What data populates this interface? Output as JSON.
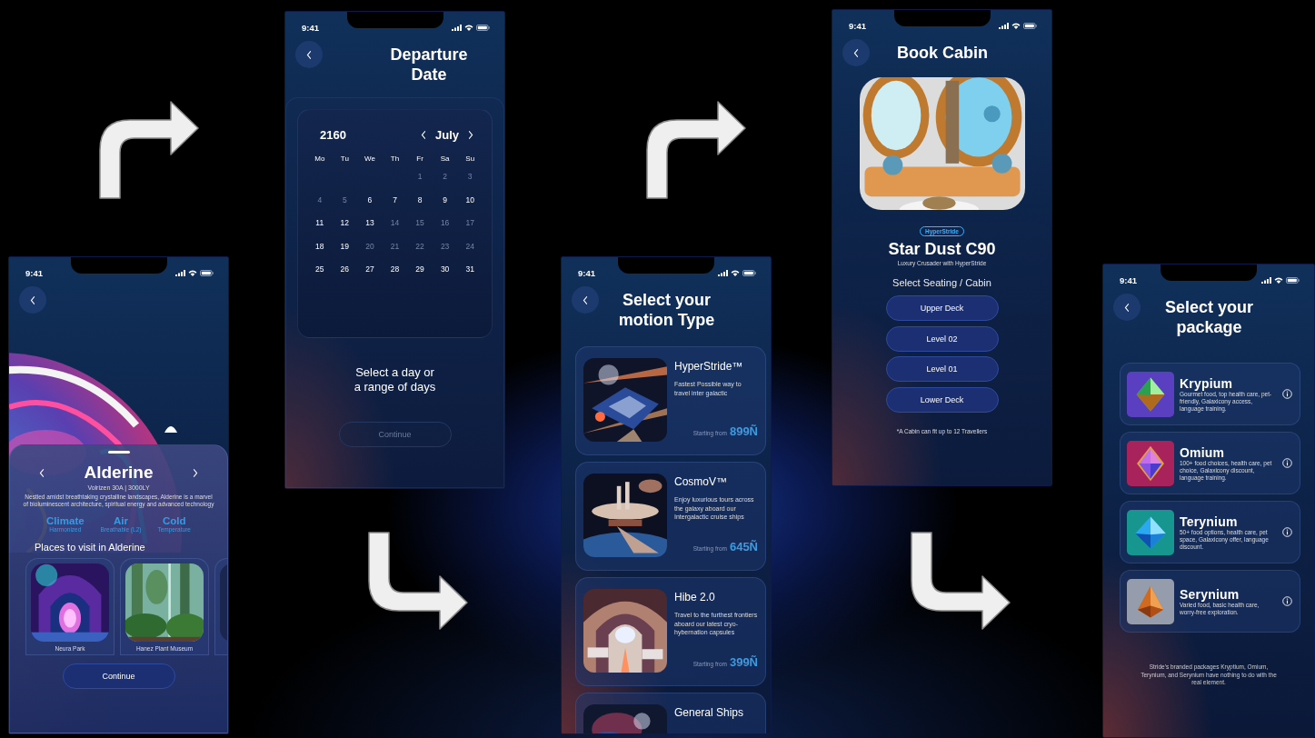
{
  "screens": [
    {
      "kind": "planet",
      "time": "9:41",
      "name": "Alderine",
      "subtitle": "Volrizen 30A | 3000LY",
      "description": "Nestled amidst breathtaking crystalline landscapes, Alderine is a marvel of bioluminescent architecture, spiritual energy and advanced technology",
      "stats": [
        {
          "value": "Climate",
          "caption": "Harmonized"
        },
        {
          "value": "Air",
          "caption": "Breathable (L2)"
        },
        {
          "value": "Cold",
          "caption": "Temperature"
        }
      ],
      "places_title": "Places to visit in Alderine",
      "places": [
        {
          "name": "Neura Park"
        },
        {
          "name": "Hanez Plant Museum"
        }
      ],
      "continue": {
        "label": "Continue",
        "disabled": false
      }
    },
    {
      "kind": "calendar",
      "time": "9:41",
      "title": "Departure Date",
      "year": "2160",
      "month": "July",
      "weekdays": [
        "Mo",
        "Tu",
        "We",
        "Th",
        "Fr",
        "Sa",
        "Su"
      ],
      "weeks": [
        [
          {
            "label": "1",
            "available": false
          },
          {
            "label": "2",
            "available": false
          },
          {
            "label": "3",
            "available": false
          }
        ],
        [
          {
            "label": "4",
            "available": false
          },
          {
            "label": "5",
            "available": false
          },
          {
            "label": "6",
            "available": true
          },
          {
            "label": "7",
            "available": true
          },
          {
            "label": "8",
            "available": true
          },
          {
            "label": "9",
            "available": true
          },
          {
            "label": "10",
            "available": true
          }
        ],
        [
          {
            "label": "11",
            "available": true
          },
          {
            "label": "12",
            "available": true
          },
          {
            "label": "13",
            "available": true
          },
          {
            "label": "14",
            "available": false
          },
          {
            "label": "15",
            "available": false
          },
          {
            "label": "16",
            "available": false
          },
          {
            "label": "17",
            "available": false
          }
        ],
        [
          {
            "label": "18",
            "available": true
          },
          {
            "label": "19",
            "available": true
          },
          {
            "label": "20",
            "available": false
          },
          {
            "label": "21",
            "available": false
          },
          {
            "label": "22",
            "available": false
          },
          {
            "label": "23",
            "available": false
          },
          {
            "label": "24",
            "available": false
          }
        ],
        [
          {
            "label": "25",
            "available": true
          },
          {
            "label": "26",
            "available": true
          },
          {
            "label": "27",
            "available": true
          },
          {
            "label": "28",
            "available": true
          },
          {
            "label": "29",
            "available": true
          },
          {
            "label": "30",
            "available": true
          },
          {
            "label": "31",
            "available": true
          }
        ]
      ],
      "prompt": "Select a day or a range of days",
      "continue": {
        "label": "Continue",
        "disabled": true
      }
    },
    {
      "kind": "ships",
      "time": "9:41",
      "title": "Select your motion Type",
      "ships": [
        {
          "name": "HyperStride™",
          "description": "Fastest Possible way to travel inter galactic",
          "price_label": "Starting from",
          "price": "899Ñ"
        },
        {
          "name": "CosmoV™",
          "description": "Enjoy luxurious tours across the galaxy aboard our Intergalactic cruise ships",
          "price_label": "Starting from",
          "price": "645Ñ"
        },
        {
          "name": "Hibe 2.0",
          "description": "Travel to the furthest frontiers aboard our latest cryo-hybernation capsules",
          "price_label": "Starting from",
          "price": "399Ñ"
        },
        {
          "name": "General Ships"
        }
      ]
    },
    {
      "kind": "cabin",
      "time": "9:41",
      "title": "Book Cabin",
      "tag": "HyperStride",
      "name": "Star Dust C90",
      "subtitle": "Luxury Crusader with HyperStride",
      "section": "Select Seating / Cabin",
      "options": [
        "Upper Deck",
        "Level 02",
        "Level 01",
        "Lower Deck"
      ],
      "note": "*A Cabin can fit up to 12 Travellers"
    },
    {
      "kind": "packages",
      "time": "9:41",
      "title": "Select your package",
      "packages": [
        {
          "name": "Krypium",
          "description": "Gourmet food, top health care, pet-friendly, Galaxicony access, language training.",
          "color": "#5a3fc0"
        },
        {
          "name": "Omium",
          "description": "100+ food choices, health care, pet choice, Galaxicony discount, language training.",
          "color": "#a8235c"
        },
        {
          "name": "Terynium",
          "description": "50+ food options, health care, pet space, Galaxicony offer, language discount.",
          "color": "#16968f"
        },
        {
          "name": "Serynium",
          "description": "Varied food, basic health care, worry-free exploration.",
          "color": "#959dac"
        }
      ],
      "footnote": "Stride's branded packages Kryptium, Omium, Terynium, and Serynium have nothing to do with the real element."
    }
  ]
}
